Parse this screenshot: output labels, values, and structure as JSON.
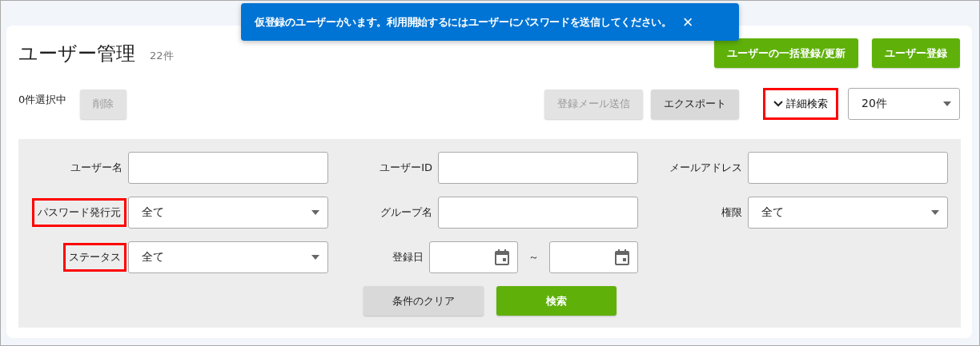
{
  "toast": {
    "message": "仮登録のユーザーがいます。利用開始するにはユーザーにパスワードを送信してください。",
    "close": "×"
  },
  "header": {
    "title": "ユーザー管理",
    "count": "22件",
    "buttons": [
      {
        "label": "ユーザーの一括登録/更新",
        "disabled": false
      },
      {
        "label": "ユーザー登録",
        "disabled": false
      }
    ]
  },
  "toolbar": {
    "selection": "0件選択中",
    "delete": {
      "label": "削除",
      "disabled": true
    },
    "actions": [
      {
        "label": "登録メール送信",
        "disabled": true
      },
      {
        "label": "エクスポート",
        "disabled": false
      }
    ],
    "advanced_search": {
      "label": "詳細検索",
      "expanded": true,
      "highlighted": true
    },
    "page_size": "20件"
  },
  "search_panel": {
    "fields": [
      {
        "label": "ユーザー名",
        "kind": "text",
        "highlighted": false
      },
      {
        "label": "ユーザーID",
        "kind": "text",
        "highlighted": false
      },
      {
        "label": "メールアドレス",
        "kind": "text",
        "highlighted": false
      },
      {
        "label": "パスワード発行元",
        "kind": "select",
        "value": "全て",
        "highlighted": true
      },
      {
        "label": "グループ名",
        "kind": "text",
        "highlighted": false
      },
      {
        "label": "権限",
        "kind": "select",
        "value": "全て",
        "highlighted": false
      },
      {
        "label": "ステータス",
        "kind": "select",
        "value": "全て",
        "highlighted": true
      },
      {
        "label": "登録日",
        "kind": "daterange",
        "separator": "～",
        "highlighted": false
      }
    ],
    "buttons": [
      {
        "label": "条件のクリア",
        "kind": "secondary"
      },
      {
        "label": "検索",
        "kind": "primary"
      }
    ]
  }
}
